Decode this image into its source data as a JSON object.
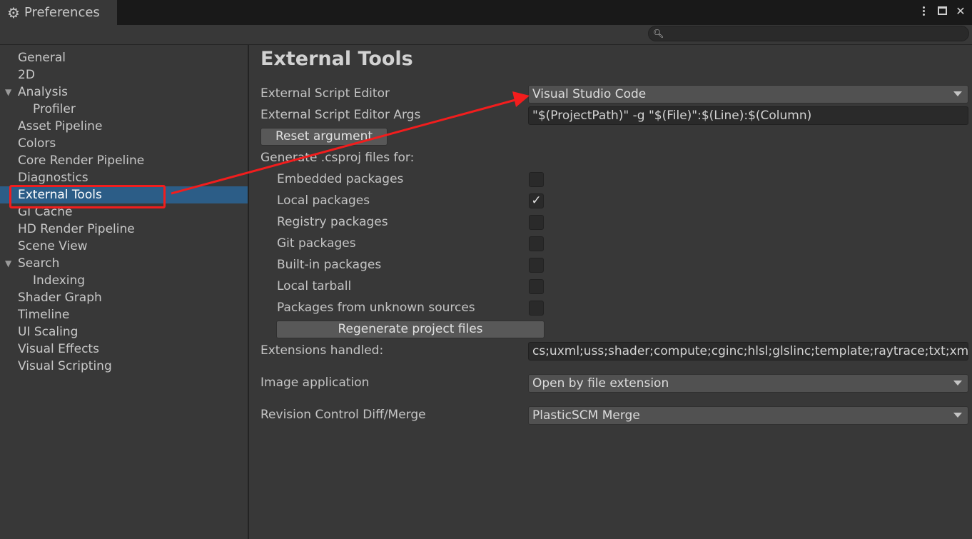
{
  "window": {
    "title": "Preferences",
    "icon": "gear-icon"
  },
  "search": {
    "placeholder": "",
    "value": ""
  },
  "sidebar": {
    "items": [
      {
        "label": "General"
      },
      {
        "label": "2D"
      },
      {
        "label": "Analysis",
        "expanded": true
      },
      {
        "label": "Profiler"
      },
      {
        "label": "Asset Pipeline"
      },
      {
        "label": "Colors"
      },
      {
        "label": "Core Render Pipeline"
      },
      {
        "label": "Diagnostics"
      },
      {
        "label": "External Tools",
        "selected": true
      },
      {
        "label": "GI Cache"
      },
      {
        "label": "HD Render Pipeline"
      },
      {
        "label": "Scene View"
      },
      {
        "label": "Search",
        "expanded": true
      },
      {
        "label": "Indexing"
      },
      {
        "label": "Shader Graph"
      },
      {
        "label": "Timeline"
      },
      {
        "label": "UI Scaling"
      },
      {
        "label": "Visual Effects"
      },
      {
        "label": "Visual Scripting"
      }
    ]
  },
  "main": {
    "title": "External Tools",
    "script_editor": {
      "label": "External Script Editor",
      "value": "Visual Studio Code"
    },
    "script_editor_args": {
      "label": "External Script Editor Args",
      "value": "\"$(ProjectPath)\" -g \"$(File)\":$(Line):$(Column)"
    },
    "reset_argument_label": "Reset argument",
    "generate_label": "Generate .csproj files for:",
    "packages": [
      {
        "label": "Embedded packages",
        "checked": false
      },
      {
        "label": "Local packages",
        "checked": true
      },
      {
        "label": "Registry packages",
        "checked": false
      },
      {
        "label": "Git packages",
        "checked": false
      },
      {
        "label": "Built-in packages",
        "checked": false
      },
      {
        "label": "Local tarball",
        "checked": false
      },
      {
        "label": "Packages from unknown sources",
        "checked": false
      }
    ],
    "check_mark": "✓",
    "regenerate_label": "Regenerate project files",
    "extensions": {
      "label": "Extensions handled:",
      "value": "cs;uxml;uss;shader;compute;cginc;hlsl;glslinc;template;raytrace;txt;xml"
    },
    "image_application": {
      "label": "Image application",
      "value": "Open by file extension"
    },
    "revision_control": {
      "label": "Revision Control Diff/Merge",
      "value": "PlasticSCM Merge"
    }
  },
  "colors": {
    "selection": "#2c5d87",
    "annotation": "#f21d1d",
    "background": "#383838"
  }
}
